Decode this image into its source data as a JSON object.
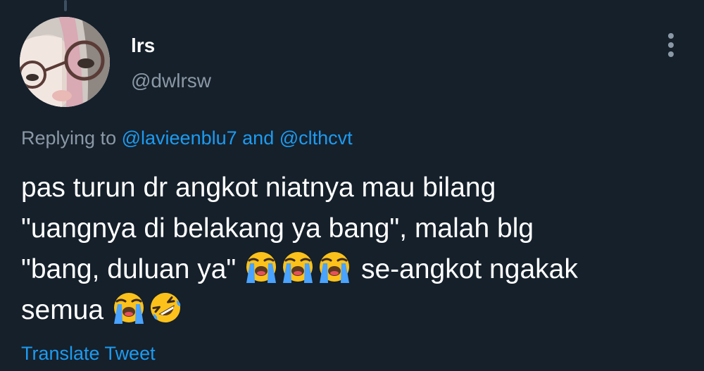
{
  "tweet": {
    "author": {
      "display_name": "lrs",
      "handle": "@dwlrsw"
    },
    "replying": {
      "prefix": "Replying to",
      "user1": "@lavieenblu7",
      "connector": "and",
      "user2": "@clthcvt"
    },
    "text_lines": {
      "line1": "pas turun dr angkot niatnya mau bilang",
      "line2": "\"uangnya di belakang ya bang\", malah blg",
      "line3_before": "\"bang, duluan ya\"",
      "line3_after": "se-angkot ngakak",
      "line4": "semua"
    },
    "emojis": {
      "line3": [
        "loudly-crying-face",
        "loudly-crying-face",
        "loudly-crying-face"
      ],
      "line4": [
        "loudly-crying-face",
        "rolling-on-the-floor-laughing"
      ]
    },
    "translate_label": "Translate Tweet"
  },
  "colors": {
    "background": "#15202b",
    "text_primary": "#ffffff",
    "text_secondary": "#8b98a5",
    "link": "#1d9bf0"
  }
}
